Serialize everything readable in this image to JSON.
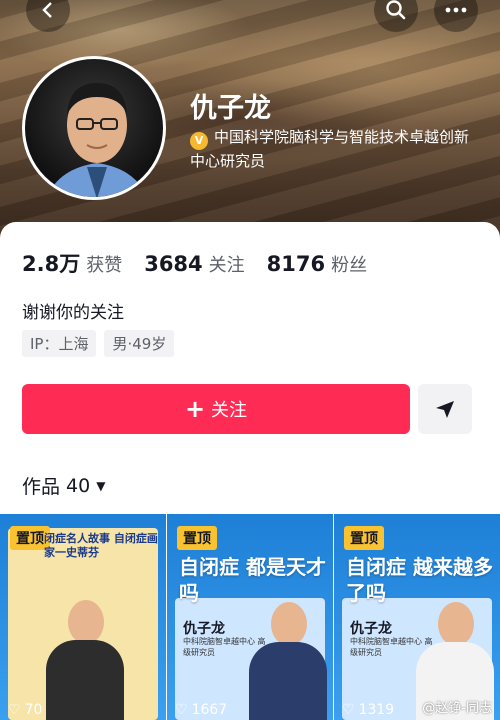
{
  "header": {
    "back_icon": "back-arrow-icon",
    "search_icon": "search-icon",
    "more_icon": "more-dots-icon"
  },
  "profile": {
    "name": "仇子龙",
    "verified_title": "中国科学院脑科学与智能技术卓越创新中心研究员",
    "verify_icon": "verified-badge-icon"
  },
  "stats": [
    {
      "value": "2.8万",
      "label": "获赞"
    },
    {
      "value": "3684",
      "label": "关注"
    },
    {
      "value": "8176",
      "label": "粉丝"
    }
  ],
  "bio": "谢谢你的关注",
  "tags": [
    "IP：上海",
    "男·49岁"
  ],
  "actions": {
    "follow_label": "关注",
    "follow_icon": "plus-icon",
    "share_icon": "send-arrow-icon",
    "accent_color": "#fe2c55"
  },
  "works": {
    "label": "作品",
    "count": "40"
  },
  "videos": [
    {
      "pin": "置顶",
      "headline": "闭症名人故事 自闭症画家一史蒂芬",
      "likes": "70",
      "name": "",
      "affil": ""
    },
    {
      "pin": "置顶",
      "headline": "自闭症 都是天才吗",
      "likes": "1667",
      "name": "仇子龙",
      "affil": "中科院脑智卓越中心 高级研究员"
    },
    {
      "pin": "置顶",
      "headline": "自闭症 越来越多了吗",
      "likes": "1319",
      "name": "仇子龙",
      "affil": "中科院脑智卓越中心 高级研究员"
    }
  ],
  "watermark": "@赵铮-同志"
}
